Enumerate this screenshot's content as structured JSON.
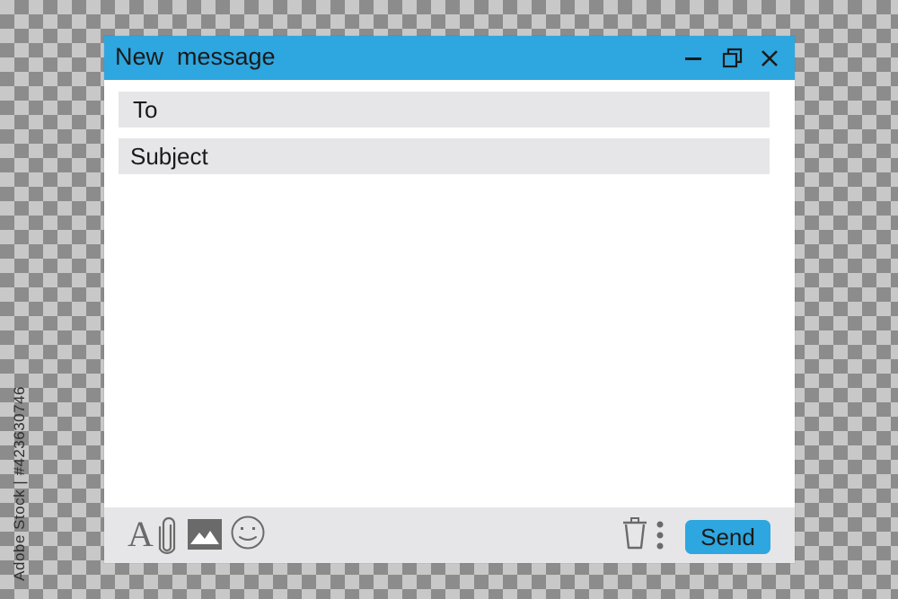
{
  "window": {
    "title": "New  message",
    "controls": {
      "minimize_icon": "minimize-icon",
      "maximize_icon": "restore-icon",
      "close_icon": "close-icon"
    }
  },
  "compose": {
    "to_placeholder": "To",
    "to_value": "",
    "subject_placeholder": "Subject",
    "subject_value": "",
    "body_value": ""
  },
  "toolbar": {
    "font_label": "A",
    "attach_icon": "paperclip-icon",
    "image_icon": "image-icon",
    "emoji_icon": "smiley-icon",
    "trash_icon": "trash-icon",
    "more_icon": "more-vertical-icon",
    "send_label": "Send"
  },
  "stock_id": "Adobe Stock | #423630746",
  "colors": {
    "accent": "#2ea6df",
    "field_bg": "#e6e6e8",
    "icon": "#6a6a6a",
    "text": "#1a1a1a"
  }
}
